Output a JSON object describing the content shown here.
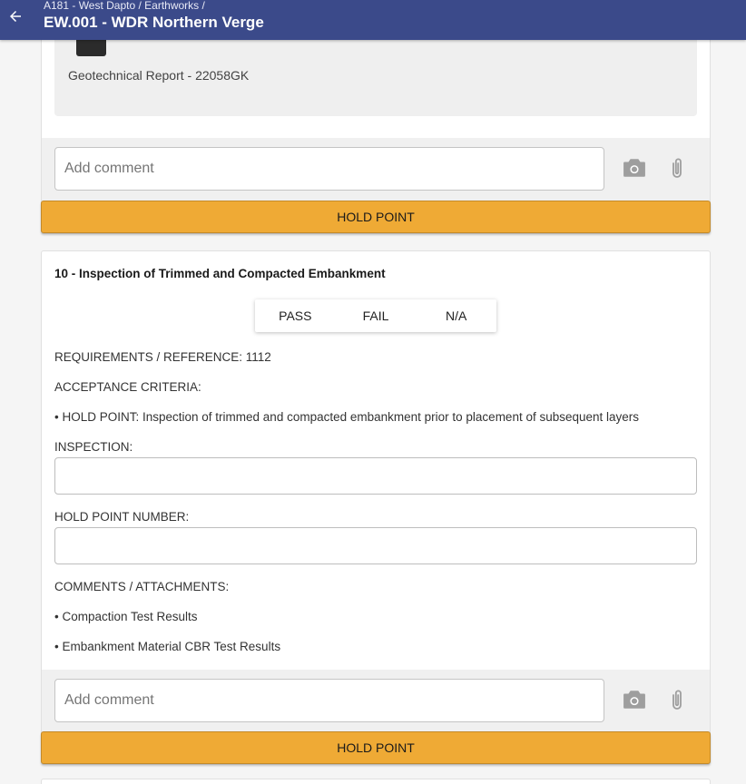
{
  "header": {
    "breadcrumb": "A181 - West Dapto / Earthworks /",
    "title": "EW.001 - WDR Northern Verge"
  },
  "prev_item": {
    "file_name": "Geotechnical Report - 22058GK",
    "comment_placeholder": "Add comment",
    "hold_button": "HOLD POINT"
  },
  "item": {
    "title": "10 - Inspection of Trimmed and Compacted Embankment",
    "options": [
      "PASS",
      "FAIL",
      "N/A"
    ],
    "requirements": "REQUIREMENTS / REFERENCE: 1112",
    "acceptance_label": "ACCEPTANCE CRITERIA:",
    "acceptance_bullet": "• HOLD POINT: Inspection of trimmed and compacted embankment prior to placement of subsequent layers",
    "inspection_label": "INSPECTION:",
    "inspection_value": "",
    "hold_point_number_label": "HOLD POINT NUMBER:",
    "hold_point_number_value": "",
    "comments_label": "COMMENTS / ATTACHMENTS:",
    "attachments": [
      "• Compaction Test Results",
      "• Embankment Material CBR Test Results"
    ],
    "comment_placeholder": "Add comment",
    "hold_button": "HOLD POINT"
  },
  "icons": {
    "back": "arrow-left-icon",
    "camera": "camera-icon",
    "attach": "paperclip-icon"
  },
  "colors": {
    "appbar": "#3b4a8a",
    "hold_point": "#efaa35"
  }
}
